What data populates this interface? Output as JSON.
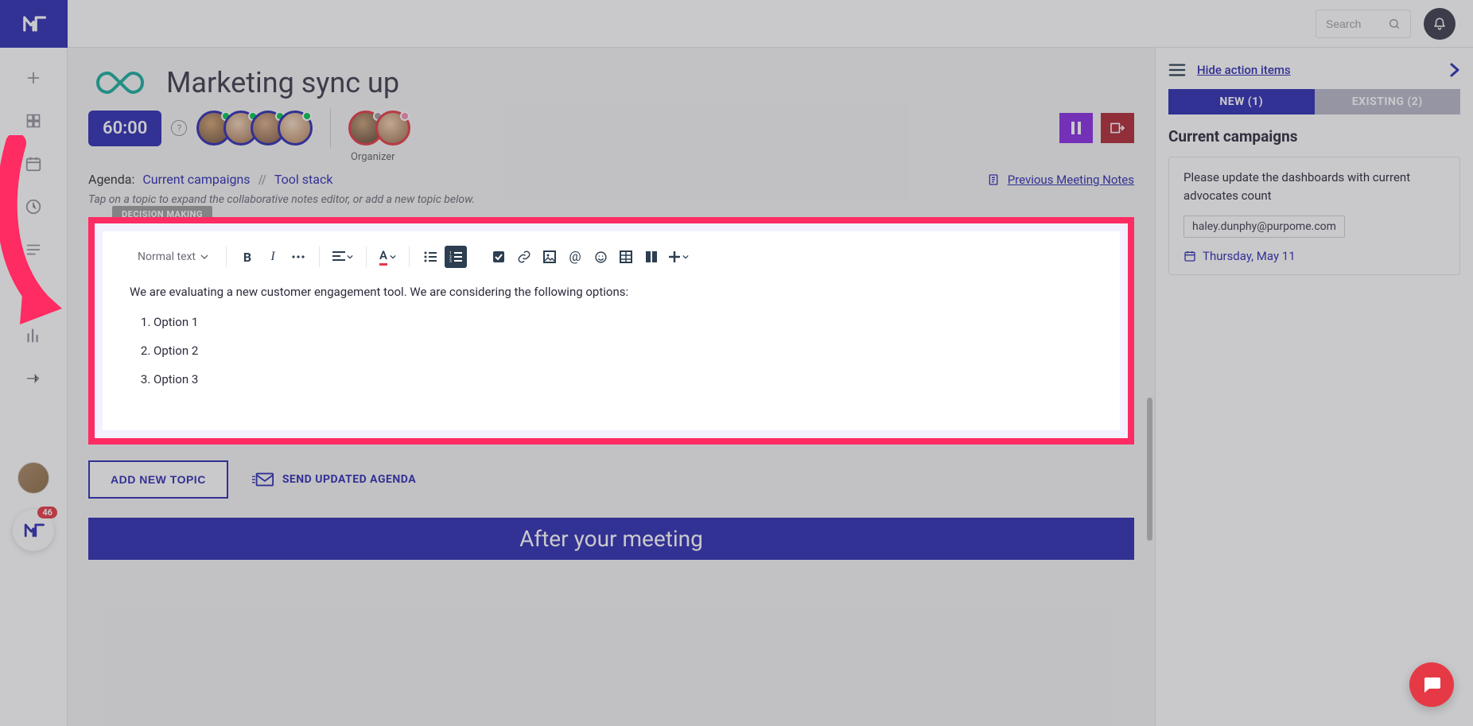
{
  "search": {
    "placeholder": "Search"
  },
  "notifications": {
    "count": "46"
  },
  "meeting": {
    "title": "Marketing sync up",
    "timer": "60:00",
    "organizer_label": "Organizer"
  },
  "agenda": {
    "label": "Agenda:",
    "items": [
      "Current campaigns",
      "Tool stack"
    ],
    "separator": "//",
    "prev_link": "Previous Meeting Notes",
    "tip": "Tap on a topic to expand the collaborative notes editor, or add a new topic below."
  },
  "editor": {
    "tag": "DECISION MAKING",
    "style_label": "Normal text",
    "body_text": "We are evaluating a new customer engagement tool. We are considering the following options:",
    "options": [
      "Option 1",
      "Option 2",
      "Option 3"
    ]
  },
  "buttons": {
    "add_topic": "ADD NEW TOPIC",
    "send_agenda": "SEND UPDATED AGENDA"
  },
  "after_bar": "After your meeting",
  "rpanel": {
    "hide_label": "Hide action items",
    "tabs": {
      "new": "NEW (1)",
      "existing": "EXISTING (2)"
    },
    "subtitle": "Current campaigns",
    "card_text": "Please update the dashboards with current advocates count",
    "email": "haley.dunphy@purpome.com",
    "date": "Thursday, May 11"
  }
}
